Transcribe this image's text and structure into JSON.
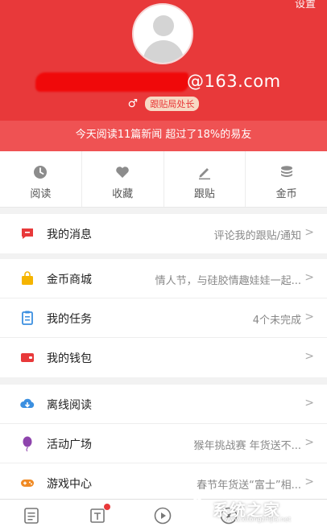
{
  "header": {
    "settings_label": "设置",
    "account_visible_suffix": "@163.com",
    "gender_symbol": "♂",
    "rank_badge": "跟贴局处长",
    "summary": "今天阅读11篇新闻 超过了18%的易友",
    "bg_color": "#e8393a"
  },
  "quick_actions": [
    {
      "label": "阅读",
      "icon": "clock-icon"
    },
    {
      "label": "收藏",
      "icon": "heart-icon"
    },
    {
      "label": "跟贴",
      "icon": "pencil-icon"
    },
    {
      "label": "金币",
      "icon": "coin-stack-icon"
    }
  ],
  "menu": {
    "messages": {
      "label": "我的消息",
      "value": "评论我的跟贴/通知",
      "icon": "message-icon",
      "color": "#e8393a"
    },
    "coin_mall": {
      "label": "金币商城",
      "value": "情人节，与硅胶情趣娃娃一起...",
      "icon": "shopping-bag-icon",
      "color": "#f5b400"
    },
    "tasks": {
      "label": "我的任务",
      "value": "4个未完成",
      "icon": "clipboard-icon",
      "color": "#3b8fe0"
    },
    "wallet": {
      "label": "我的钱包",
      "value": "",
      "icon": "wallet-icon",
      "color": "#e8393a"
    },
    "offline": {
      "label": "离线阅读",
      "value": "",
      "icon": "cloud-download-icon",
      "color": "#3b8fe0"
    },
    "activity": {
      "label": "活动广场",
      "value": "猴年挑战赛 年货送不...",
      "icon": "balloon-icon",
      "color": "#8e44ad"
    },
    "games": {
      "label": "游戏中心",
      "value": "春节年货送“富士”相...",
      "icon": "gamepad-icon",
      "color": "#f08a24"
    }
  },
  "chevron": ">",
  "watermark": {
    "text": "系统之家",
    "url": "www.xitongzhijia.net"
  }
}
